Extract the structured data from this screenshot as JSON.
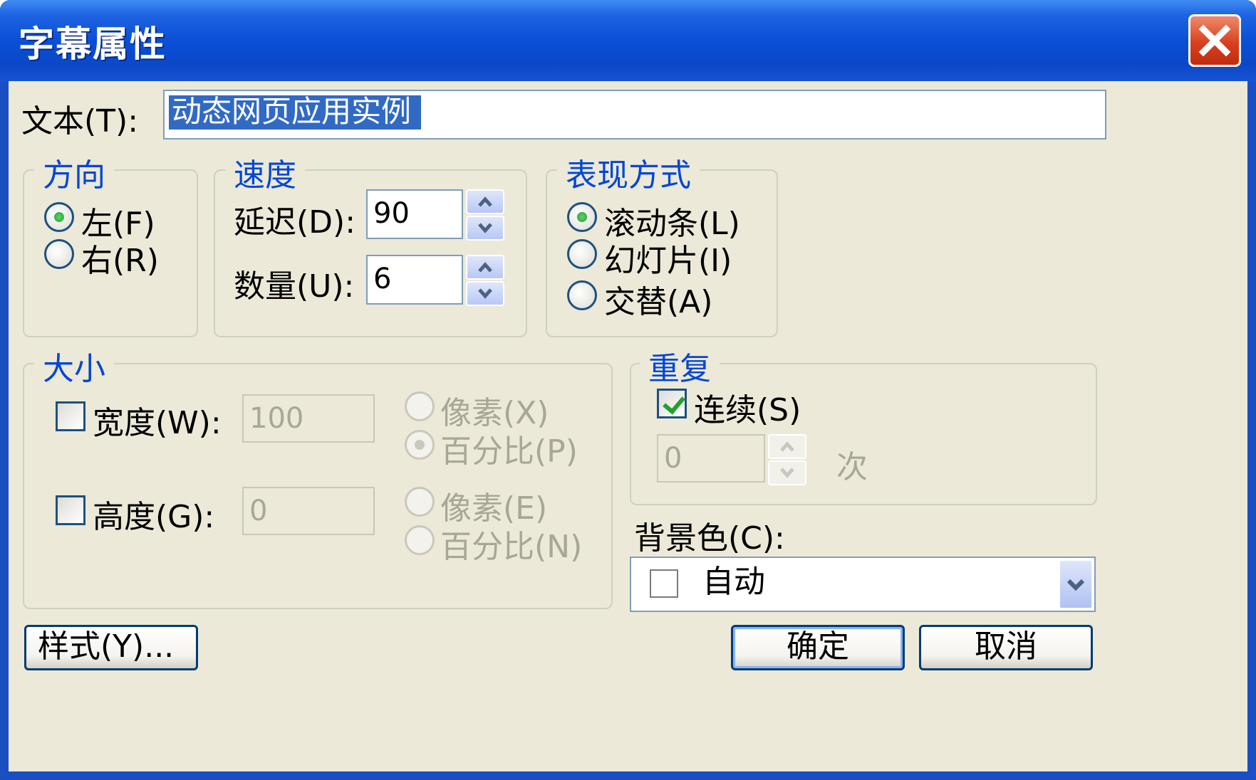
{
  "window": {
    "title": "字幕属性"
  },
  "text_field": {
    "label": "文本(T):",
    "value": "动态网页应用实例"
  },
  "direction": {
    "title": "方向",
    "options": [
      {
        "label": "左(F)",
        "checked": true
      },
      {
        "label": "右(R)",
        "checked": false
      }
    ]
  },
  "speed": {
    "title": "速度",
    "delay_label": "延迟(D):",
    "delay_value": "90",
    "amount_label": "数量(U):",
    "amount_value": "6"
  },
  "behavior": {
    "title": "表现方式",
    "options": [
      {
        "label": "滚动条(L)",
        "checked": true
      },
      {
        "label": "幻灯片(I)",
        "checked": false
      },
      {
        "label": "交替(A)",
        "checked": false
      }
    ]
  },
  "size": {
    "title": "大小",
    "width_label": "宽度(W):",
    "width_value": "100",
    "width_pixels_label": "像素(X)",
    "width_percent_label": "百分比(P)",
    "height_label": "高度(G):",
    "height_value": "0",
    "height_pixels_label": "像素(E)",
    "height_percent_label": "百分比(N)"
  },
  "repeat": {
    "title": "重复",
    "continuous_label": "连续(S)",
    "continuous_checked": true,
    "count_value": "0",
    "times_label": "次"
  },
  "background": {
    "label": "背景色(C):",
    "value": "自动"
  },
  "buttons": {
    "style_label": "样式(Y)...",
    "ok_label": "确定",
    "cancel_label": "取消"
  },
  "colors": {
    "title_bar": "#0a48c8",
    "dialog_face": "#ece9d8",
    "group_title": "#0046d5",
    "selection": "#316ac5",
    "close_button": "#d8401e"
  }
}
